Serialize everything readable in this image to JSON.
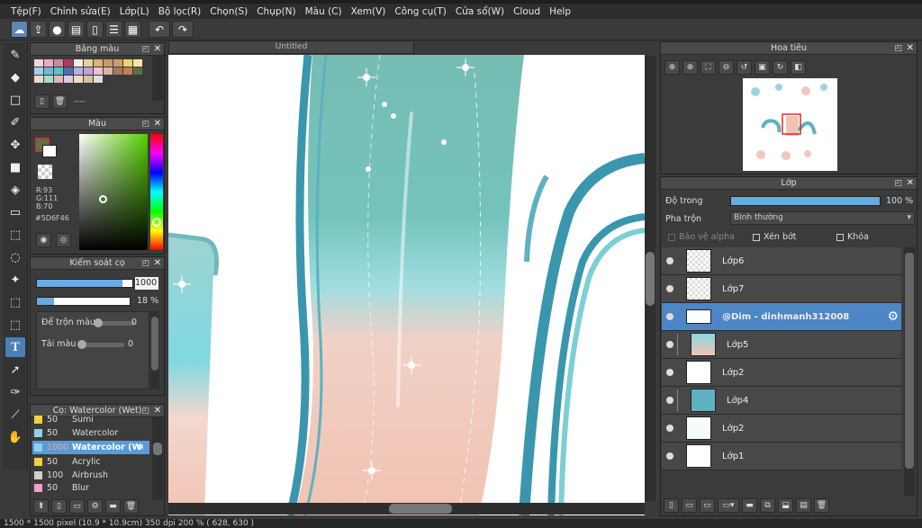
{
  "menu": [
    "Tệp(F)",
    "Chỉnh sửa(E)",
    "Lớp(L)",
    "Bộ lọc(R)",
    "Chọn(S)",
    "Chụp(N)",
    "Màu (C)",
    "Xem(V)",
    "Công cụ(T)",
    "Cửa sổ(W)",
    "Cloud",
    "Help"
  ],
  "document_tab": "Untitled",
  "palette_panel": {
    "title": "Bảng màu",
    "set_label": "----"
  },
  "color_panel": {
    "title": "Màu",
    "r": "R:93",
    "g": "G:111",
    "b": "B:70",
    "hex": "#5D6F46",
    "fg_color": "#5d6f46"
  },
  "brush_control": {
    "title": "Kiểm soát cọ",
    "size": "1000",
    "opacity": "18 %",
    "opacity_fraction": 0.18,
    "size_fraction": 0.9,
    "blend_label": "Để trộn màu",
    "blend_value": "0",
    "dilution_label": "Tải màu",
    "dilution_value": "0"
  },
  "brush_panel": {
    "title": "Cọ: Watercolor (Wet)",
    "items": [
      {
        "num": "50",
        "name": "Sumi",
        "color": "#f0d23c"
      },
      {
        "num": "50",
        "name": "Watercolor",
        "color": "#8fd0ef"
      },
      {
        "num": "1000",
        "name": "Watercolor (Wet)",
        "color": "#8fd0ef"
      },
      {
        "num": "50",
        "name": "Acrylic",
        "color": "#f0d23c"
      },
      {
        "num": "100",
        "name": "Airbrush",
        "color": "#cfcfcf"
      },
      {
        "num": "50",
        "name": "Blur",
        "color": "#f0a0c8"
      }
    ]
  },
  "navigator": {
    "title": "Hoa tiêu"
  },
  "layer_panel": {
    "title": "Lớp",
    "opacity_label": "Độ trong",
    "opacity_value": "100 %",
    "opacity_fraction": 1.0,
    "blend_label": "Pha trộn",
    "blend_value": "Bình thường",
    "protect_alpha": "Bảo vệ alpha",
    "clipping": "Xén bớt",
    "lock": "Khóa",
    "layers": [
      {
        "name": "Lớp6"
      },
      {
        "name": "Lớp7"
      },
      {
        "name": "@Dim - dinhmanh312008"
      },
      {
        "name": "Lớp5"
      },
      {
        "name": "Lớp2"
      },
      {
        "name": "Lớp4"
      },
      {
        "name": "Lớp2"
      },
      {
        "name": "Lớp1"
      }
    ]
  },
  "status": "1500 * 1500 pixel   (10.9 * 10.9cm)   350 dpi   200 %   ( 628, 630 )"
}
